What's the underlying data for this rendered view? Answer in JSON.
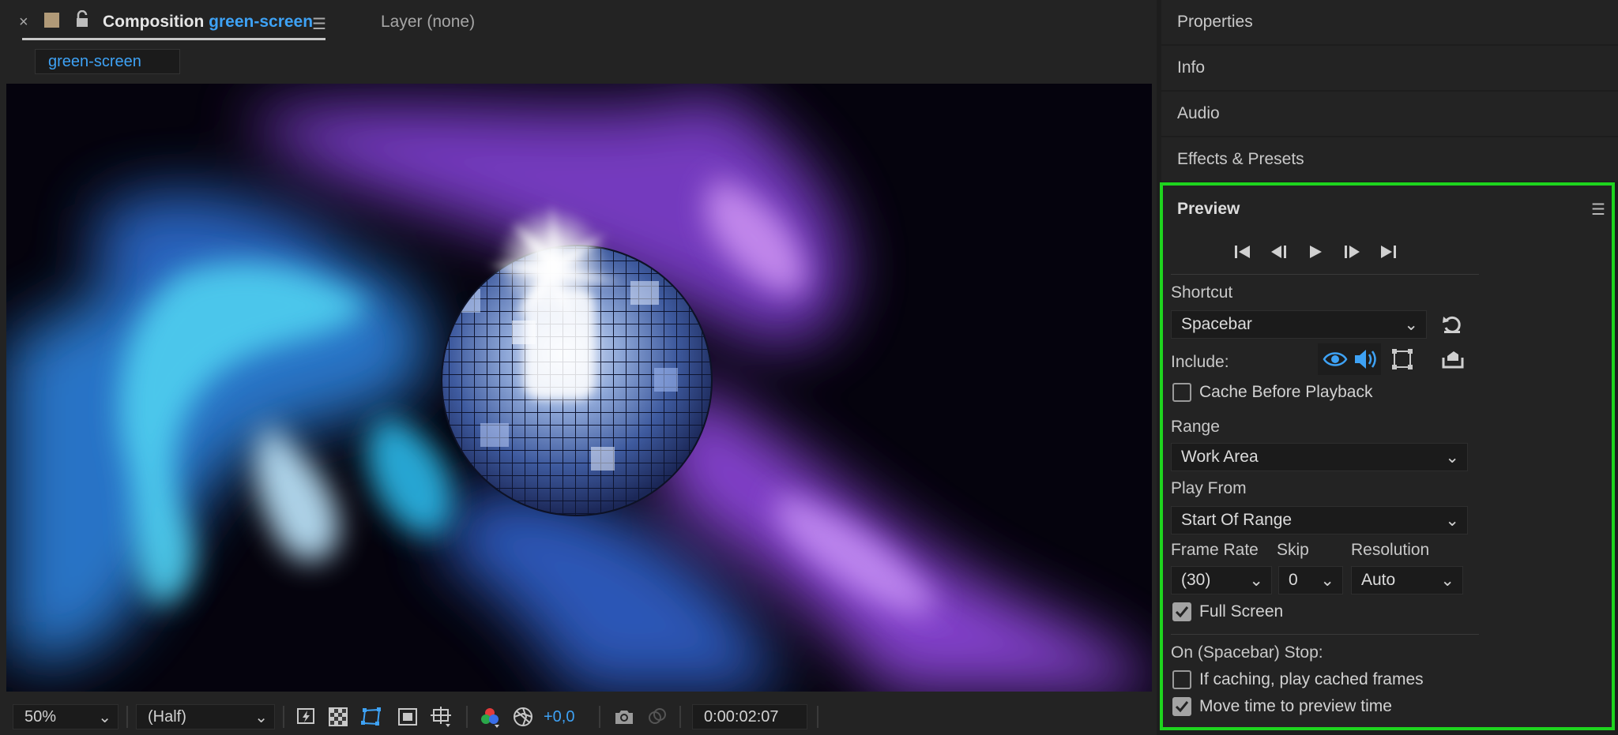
{
  "composition_panel": {
    "tab": {
      "title_prefix": "Composition",
      "comp_name": "green-screen",
      "layer_tab": "Layer (none)"
    },
    "subtab_label": "green-screen",
    "toolbar": {
      "magnification": "50%",
      "resolution": "(Half)",
      "exposure": "+0,0",
      "timecode": "0:00:02:07"
    }
  },
  "right_panels": {
    "collapsed": [
      "Properties",
      "Info",
      "Audio",
      "Effects & Presets"
    ]
  },
  "preview_panel": {
    "title": "Preview",
    "shortcut_label": "Shortcut",
    "shortcut_value": "Spacebar",
    "include_label": "Include:",
    "cache_before_playback": {
      "label": "Cache Before Playback",
      "checked": false
    },
    "range_label": "Range",
    "range_value": "Work Area",
    "play_from_label": "Play From",
    "play_from_value": "Start Of Range",
    "frame_rate_label": "Frame Rate",
    "frame_rate_value": "(30)",
    "skip_label": "Skip",
    "skip_value": "0",
    "resolution_label": "Resolution",
    "resolution_value": "Auto",
    "full_screen": {
      "label": "Full Screen",
      "checked": true
    },
    "on_stop_label": "On (Spacebar) Stop:",
    "if_caching": {
      "label": "If caching, play cached frames",
      "checked": false
    },
    "move_time": {
      "label": "Move time to preview time",
      "checked": true
    }
  },
  "colors": {
    "accent_blue": "#3ea2f5",
    "highlight_green": "#1ed41e",
    "panel_bg": "#232323"
  }
}
